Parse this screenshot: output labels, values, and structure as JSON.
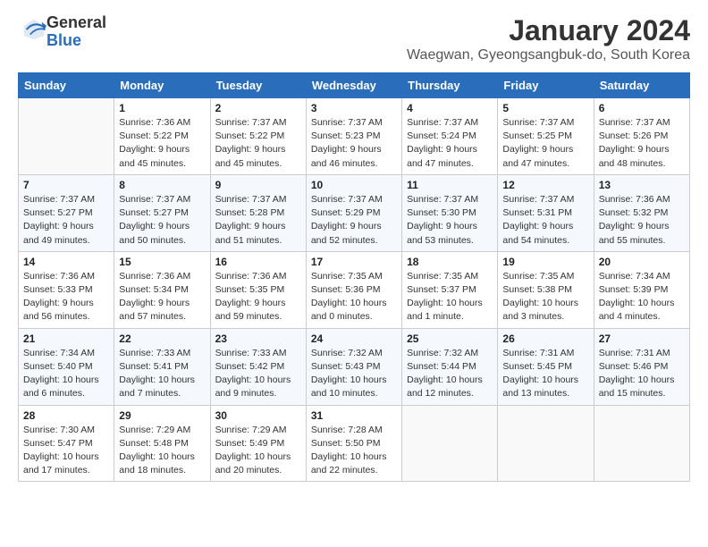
{
  "header": {
    "logo_general": "General",
    "logo_blue": "Blue",
    "month_title": "January 2024",
    "location": "Waegwan, Gyeongsangbuk-do, South Korea"
  },
  "days_of_week": [
    "Sunday",
    "Monday",
    "Tuesday",
    "Wednesday",
    "Thursday",
    "Friday",
    "Saturday"
  ],
  "weeks": [
    [
      {
        "day": "",
        "info": ""
      },
      {
        "day": "1",
        "info": "Sunrise: 7:36 AM\nSunset: 5:22 PM\nDaylight: 9 hours\nand 45 minutes."
      },
      {
        "day": "2",
        "info": "Sunrise: 7:37 AM\nSunset: 5:22 PM\nDaylight: 9 hours\nand 45 minutes."
      },
      {
        "day": "3",
        "info": "Sunrise: 7:37 AM\nSunset: 5:23 PM\nDaylight: 9 hours\nand 46 minutes."
      },
      {
        "day": "4",
        "info": "Sunrise: 7:37 AM\nSunset: 5:24 PM\nDaylight: 9 hours\nand 47 minutes."
      },
      {
        "day": "5",
        "info": "Sunrise: 7:37 AM\nSunset: 5:25 PM\nDaylight: 9 hours\nand 47 minutes."
      },
      {
        "day": "6",
        "info": "Sunrise: 7:37 AM\nSunset: 5:26 PM\nDaylight: 9 hours\nand 48 minutes."
      }
    ],
    [
      {
        "day": "7",
        "info": "Sunrise: 7:37 AM\nSunset: 5:27 PM\nDaylight: 9 hours\nand 49 minutes."
      },
      {
        "day": "8",
        "info": "Sunrise: 7:37 AM\nSunset: 5:27 PM\nDaylight: 9 hours\nand 50 minutes."
      },
      {
        "day": "9",
        "info": "Sunrise: 7:37 AM\nSunset: 5:28 PM\nDaylight: 9 hours\nand 51 minutes."
      },
      {
        "day": "10",
        "info": "Sunrise: 7:37 AM\nSunset: 5:29 PM\nDaylight: 9 hours\nand 52 minutes."
      },
      {
        "day": "11",
        "info": "Sunrise: 7:37 AM\nSunset: 5:30 PM\nDaylight: 9 hours\nand 53 minutes."
      },
      {
        "day": "12",
        "info": "Sunrise: 7:37 AM\nSunset: 5:31 PM\nDaylight: 9 hours\nand 54 minutes."
      },
      {
        "day": "13",
        "info": "Sunrise: 7:36 AM\nSunset: 5:32 PM\nDaylight: 9 hours\nand 55 minutes."
      }
    ],
    [
      {
        "day": "14",
        "info": "Sunrise: 7:36 AM\nSunset: 5:33 PM\nDaylight: 9 hours\nand 56 minutes."
      },
      {
        "day": "15",
        "info": "Sunrise: 7:36 AM\nSunset: 5:34 PM\nDaylight: 9 hours\nand 57 minutes."
      },
      {
        "day": "16",
        "info": "Sunrise: 7:36 AM\nSunset: 5:35 PM\nDaylight: 9 hours\nand 59 minutes."
      },
      {
        "day": "17",
        "info": "Sunrise: 7:35 AM\nSunset: 5:36 PM\nDaylight: 10 hours\nand 0 minutes."
      },
      {
        "day": "18",
        "info": "Sunrise: 7:35 AM\nSunset: 5:37 PM\nDaylight: 10 hours\nand 1 minute."
      },
      {
        "day": "19",
        "info": "Sunrise: 7:35 AM\nSunset: 5:38 PM\nDaylight: 10 hours\nand 3 minutes."
      },
      {
        "day": "20",
        "info": "Sunrise: 7:34 AM\nSunset: 5:39 PM\nDaylight: 10 hours\nand 4 minutes."
      }
    ],
    [
      {
        "day": "21",
        "info": "Sunrise: 7:34 AM\nSunset: 5:40 PM\nDaylight: 10 hours\nand 6 minutes."
      },
      {
        "day": "22",
        "info": "Sunrise: 7:33 AM\nSunset: 5:41 PM\nDaylight: 10 hours\nand 7 minutes."
      },
      {
        "day": "23",
        "info": "Sunrise: 7:33 AM\nSunset: 5:42 PM\nDaylight: 10 hours\nand 9 minutes."
      },
      {
        "day": "24",
        "info": "Sunrise: 7:32 AM\nSunset: 5:43 PM\nDaylight: 10 hours\nand 10 minutes."
      },
      {
        "day": "25",
        "info": "Sunrise: 7:32 AM\nSunset: 5:44 PM\nDaylight: 10 hours\nand 12 minutes."
      },
      {
        "day": "26",
        "info": "Sunrise: 7:31 AM\nSunset: 5:45 PM\nDaylight: 10 hours\nand 13 minutes."
      },
      {
        "day": "27",
        "info": "Sunrise: 7:31 AM\nSunset: 5:46 PM\nDaylight: 10 hours\nand 15 minutes."
      }
    ],
    [
      {
        "day": "28",
        "info": "Sunrise: 7:30 AM\nSunset: 5:47 PM\nDaylight: 10 hours\nand 17 minutes."
      },
      {
        "day": "29",
        "info": "Sunrise: 7:29 AM\nSunset: 5:48 PM\nDaylight: 10 hours\nand 18 minutes."
      },
      {
        "day": "30",
        "info": "Sunrise: 7:29 AM\nSunset: 5:49 PM\nDaylight: 10 hours\nand 20 minutes."
      },
      {
        "day": "31",
        "info": "Sunrise: 7:28 AM\nSunset: 5:50 PM\nDaylight: 10 hours\nand 22 minutes."
      },
      {
        "day": "",
        "info": ""
      },
      {
        "day": "",
        "info": ""
      },
      {
        "day": "",
        "info": ""
      }
    ]
  ]
}
